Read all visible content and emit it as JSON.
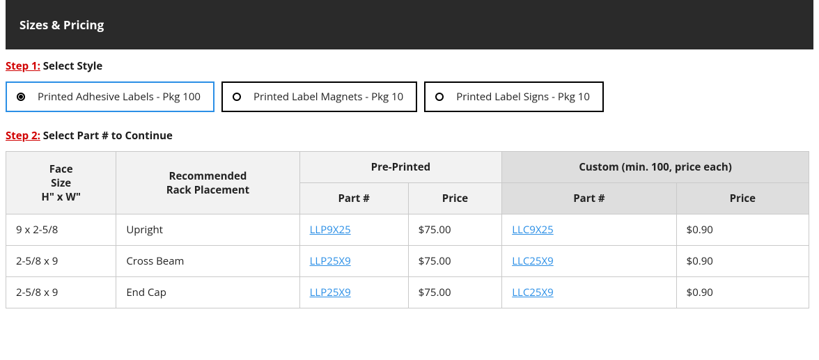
{
  "header": {
    "title": "Sizes & Pricing"
  },
  "step1": {
    "label": "Step 1:",
    "text": "Select Style",
    "options": [
      {
        "label": "Printed Adhesive Labels - Pkg 100",
        "selected": true
      },
      {
        "label": "Printed Label Magnets - Pkg 10",
        "selected": false
      },
      {
        "label": "Printed Label Signs - Pkg 10",
        "selected": false
      }
    ]
  },
  "step2": {
    "label": "Step 2:",
    "text": "Select Part # to Continue"
  },
  "table": {
    "headers": {
      "face_size_line1": "Face",
      "face_size_line2": "Size",
      "face_size_line3": "H\" x W\"",
      "placement_line1": "Recommended",
      "placement_line2": "Rack Placement",
      "preprinted": "Pre-Printed",
      "custom": "Custom (min. 100, price each)",
      "part": "Part #",
      "price": "Price"
    },
    "rows": [
      {
        "face_size": "9 x 2-5/8",
        "placement": "Upright",
        "pre_part": "LLP9X25",
        "pre_price": "$75.00",
        "cust_part": "LLC9X25",
        "cust_price": "$0.90"
      },
      {
        "face_size": "2-5/8 x 9",
        "placement": "Cross Beam",
        "pre_part": "LLP25X9",
        "pre_price": "$75.00",
        "cust_part": "LLC25X9",
        "cust_price": "$0.90"
      },
      {
        "face_size": "2-5/8 x 9",
        "placement": "End Cap",
        "pre_part": "LLP25X9",
        "pre_price": "$75.00",
        "cust_part": "LLC25X9",
        "cust_price": "$0.90"
      }
    ]
  }
}
